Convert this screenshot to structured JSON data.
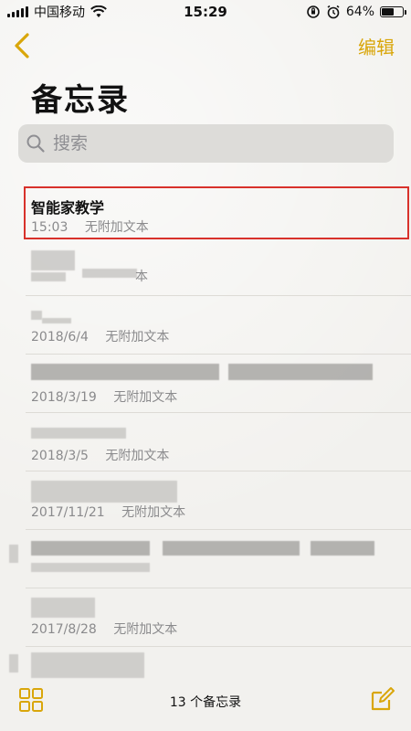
{
  "status": {
    "carrier": "中国移动",
    "time": "15:29",
    "battery": "64%",
    "battery_level": 0.64
  },
  "nav": {
    "edit_label": "编辑"
  },
  "page_title": "备忘录",
  "search": {
    "placeholder": "搜索"
  },
  "notes": [
    {
      "title": "智能家教学",
      "date": "15:03",
      "preview": "无附加文本",
      "selected": true
    },
    {
      "title": "",
      "date": "",
      "preview": "本"
    },
    {
      "title": "",
      "date": "2018/6/4",
      "preview": "无附加文本"
    },
    {
      "title": "",
      "date": "2018/3/19",
      "preview": "无附加文本"
    },
    {
      "title": "",
      "date": "2018/3/5",
      "preview": "无附加文本"
    },
    {
      "title": "",
      "date": "2017/11/21",
      "preview": "无附加文本"
    },
    {
      "title": "",
      "date": "",
      "preview": ""
    },
    {
      "title": "",
      "date": "2017/8/28",
      "preview": "无附加文本"
    }
  ],
  "toolbar": {
    "count_label": "13 个备忘录"
  },
  "colors": {
    "accent": "#d9a60a",
    "highlight_border": "#d8312b",
    "background": "#f2f1ee"
  },
  "icons": [
    "back-chevron-icon",
    "search-icon",
    "grid-icon",
    "compose-icon",
    "wifi-icon",
    "battery-icon",
    "alarm-icon",
    "orientation-lock-icon"
  ]
}
